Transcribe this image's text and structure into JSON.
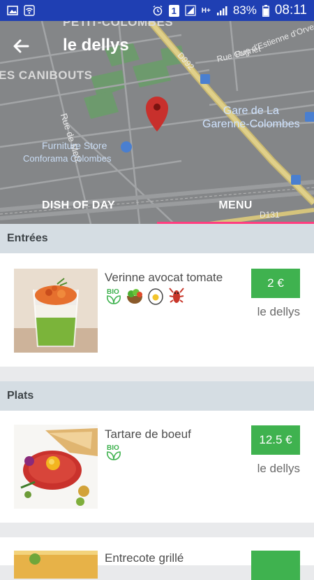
{
  "status_bar": {
    "badge": "1",
    "network": "H+",
    "battery": "83%",
    "time": "08:11"
  },
  "header": {
    "title": "le dellys"
  },
  "map": {
    "labels": {
      "petit_colombes": "PETIT-COLOMBES",
      "caniboutes": "ES CANIBOUTS",
      "rue_de_metz": "Rue de Metz",
      "d992": "D992",
      "rue_cugnet": "Rue Cugnet",
      "rue_estienne": "Rue d'Estienne d'Orves",
      "gare_line1": "Gare de La",
      "gare_line2": "Garenne-Colombes",
      "furniture": "Furniture Store",
      "conforama": "Conforama Colombes",
      "d131": "D131"
    }
  },
  "tabs": [
    {
      "label": "DISH OF DAY",
      "active": false
    },
    {
      "label": "MENU",
      "active": true
    }
  ],
  "sections": [
    {
      "title": "Entrées",
      "items": [
        {
          "name": "Verinne avocat tomate",
          "price": "2 €",
          "restaurant": "le dellys",
          "tags": [
            "bio-icon",
            "salad-icon",
            "egg-icon",
            "shrimp-icon"
          ]
        }
      ]
    },
    {
      "title": "Plats",
      "items": [
        {
          "name": "Tartare de boeuf",
          "price": "12.5 €",
          "restaurant": "le dellys",
          "tags": [
            "bio-icon"
          ]
        },
        {
          "name": "Entrecote grillé",
          "price": "",
          "restaurant": "",
          "tags": []
        }
      ]
    }
  ],
  "colors": {
    "status_bar": "#1f3fb3",
    "price_green": "#3fb24f",
    "tab_indicator": "#ff3d7f",
    "section_header": "#d5dde3"
  }
}
